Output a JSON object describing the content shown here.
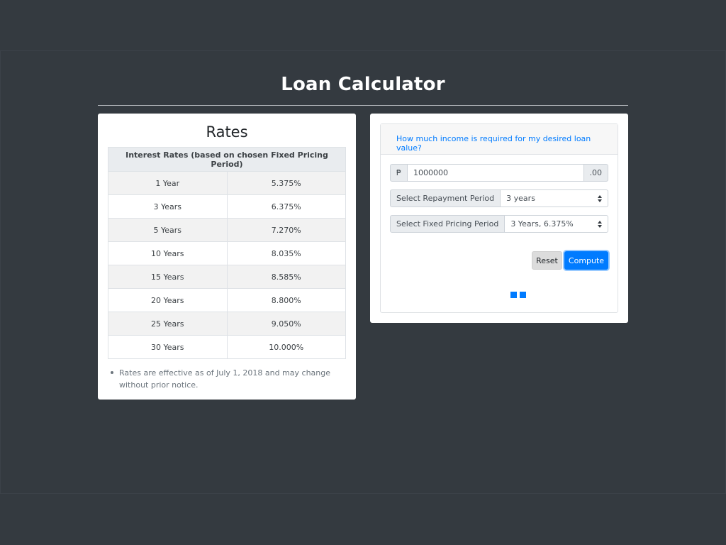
{
  "page_title": "Loan Calculator",
  "rates": {
    "title": "Rates",
    "table_header": "Interest Rates (based on chosen Fixed Pricing Period)",
    "rows": [
      {
        "period": "1 Year",
        "rate": "5.375%"
      },
      {
        "period": "3 Years",
        "rate": "6.375%"
      },
      {
        "period": "5 Years",
        "rate": "7.270%"
      },
      {
        "period": "10 Years",
        "rate": "8.035%"
      },
      {
        "period": "15 Years",
        "rate": "8.585%"
      },
      {
        "period": "20 Years",
        "rate": "8.800%"
      },
      {
        "period": "25 Years",
        "rate": "9.050%"
      },
      {
        "period": "30 Years",
        "rate": "10.000%"
      }
    ],
    "note": "Rates are effective as of July 1, 2018 and may change without prior notice."
  },
  "calculator": {
    "header_link": "How much income is required for my desired loan value?",
    "loan_amount": {
      "currency_symbol": "₱",
      "value": "1000000",
      "suffix": ".00"
    },
    "repayment": {
      "label": "Select Repayment Period",
      "selected": "3 years"
    },
    "pricing": {
      "label": "Select Fixed Pricing Period",
      "selected": "3 Years, 6.375%"
    },
    "reset_label": "Reset",
    "compute_label": "Compute"
  },
  "colors": {
    "background": "#343a40",
    "accent": "#007bff"
  }
}
